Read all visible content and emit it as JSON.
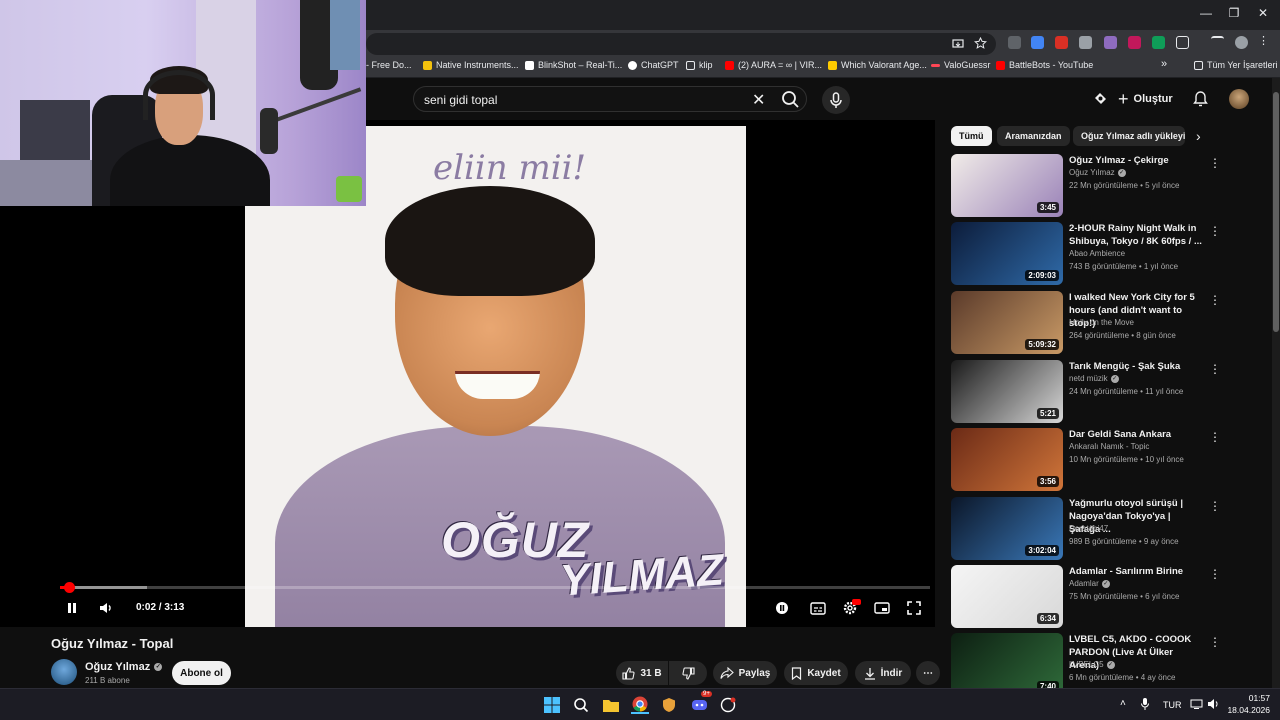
{
  "browser": {
    "window_controls": {
      "minimize": "—",
      "maximize": "❐",
      "close": "✕"
    },
    "bookmarks": [
      {
        "label": "- Free Do...",
        "color": "#e8eaed"
      },
      {
        "label": "Native Instruments...",
        "color": "#f4c20d"
      },
      {
        "label": "BlinkShot – Real-Ti...",
        "color": "#ffffff"
      },
      {
        "label": "ChatGPT",
        "color": "#ffffff"
      },
      {
        "label": "klip",
        "color": "#e8eaed"
      },
      {
        "label": "(2) AURA = ∞ | VIR...",
        "color": "#ff0000"
      },
      {
        "label": "Which Valorant Age...",
        "color": "#ffcc00"
      },
      {
        "label": "ValoGuessr",
        "color": "#ff4655"
      },
      {
        "label": "BattleBots - YouTube",
        "color": "#ff0000"
      }
    ],
    "more_bookmarks": "»",
    "all_bookmarks": "Tüm Yer İşaretleri"
  },
  "youtube": {
    "search": {
      "value": "seni gidi topal",
      "clear": "✕"
    },
    "create_label": "Oluştur",
    "player": {
      "time": "0:02 / 3:13",
      "progress_fraction": 0.0104,
      "buffered_fraction": 0.1,
      "art_text_top": "eliin mii!",
      "art_name_1": "OĞUZ",
      "art_name_2": "YILMAZ"
    },
    "video": {
      "title": "Oğuz Yılmaz - Topal",
      "channel": "Oğuz Yılmaz",
      "subscribers": "211 B abone",
      "subscribe_label": "Abone ol",
      "likes": "31 B",
      "share_label": "Paylaş",
      "save_label": "Kaydet",
      "download_label": "İndir",
      "more": "⋯"
    },
    "chips": [
      "Tümü",
      "Aramanızdan",
      "Oğuz Yılmaz adlı yükleyi"
    ],
    "recommendations": [
      {
        "title": "Oğuz Yılmaz - Çekirge",
        "channel": "Oğuz Yılmaz",
        "verified": true,
        "meta": "22 Mn görüntüleme • 5 yıl önce",
        "duration": "3:45",
        "thumb_a": "#f1ece8",
        "thumb_b": "#9a82b8"
      },
      {
        "title": "2-HOUR Rainy Night Walk in Shibuya, Tokyo / 8K 60fps / ...",
        "channel": "Abao Ambience",
        "verified": false,
        "meta": "743 B görüntüleme • 1 yıl önce",
        "duration": "2:09:03",
        "thumb_a": "#0c1c3a",
        "thumb_b": "#2f6aa8"
      },
      {
        "title": "I walked New York City for 5 hours (and didn't want to stop!)",
        "channel": "Molly on the Move",
        "verified": false,
        "meta": "264 görüntüleme • 8 gün önce",
        "duration": "5:09:32",
        "thumb_a": "#5a3a2a",
        "thumb_b": "#c99a66"
      },
      {
        "title": "Tarık Mengüç - Şak Şuka",
        "channel": "netd müzik",
        "verified": true,
        "meta": "24 Mn görüntüleme • 11 yıl önce",
        "duration": "5:21",
        "thumb_a": "#1a1a1a",
        "thumb_b": "#d8d8d8"
      },
      {
        "title": "Dar Geldi Sana Ankara",
        "channel": "Ankaralı Namık - Topic",
        "verified": false,
        "meta": "10 Mn görüntüleme • 10 yıl önce",
        "duration": "3:56",
        "thumb_a": "#6b2a16",
        "thumb_b": "#d1763a"
      },
      {
        "title": "Yağmurlu otoyol sürüşü | Nagoya'dan Tokyo'ya | Şafağa ...",
        "channel": "Doratabi47",
        "verified": false,
        "meta": "989 B görüntüleme • 9 ay önce",
        "duration": "3:02:04",
        "thumb_a": "#0b1628",
        "thumb_b": "#3a78b8"
      },
      {
        "title": "Adamlar - Sarılırım Birine",
        "channel": "Adamlar",
        "verified": true,
        "meta": "75 Mn görüntüleme • 6 yıl önce",
        "duration": "6:34",
        "thumb_a": "#f5f5f5",
        "thumb_b": "#d8d8d8"
      },
      {
        "title": "LVBEL C5, AKDO - COOOK PARDON (Live At Ülker Arena)",
        "channel": "LVBELC5",
        "verified": true,
        "meta": "6 Mn görüntüleme • 4 ay önce",
        "duration": "7:40",
        "thumb_a": "#0d1f12",
        "thumb_b": "#2f6b3a"
      }
    ]
  },
  "taskbar": {
    "language": "TUR",
    "time": "01:57",
    "date": "18.04.2026",
    "discord_badge": "9+"
  }
}
